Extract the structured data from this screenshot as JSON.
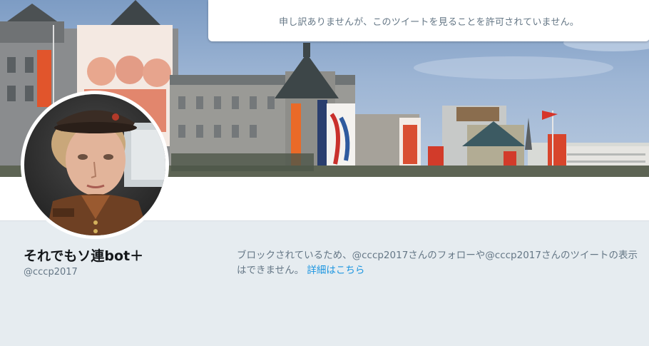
{
  "notice": {
    "text": "申し訳ありませんが、このツイートを見ることを許可されていません。"
  },
  "profile": {
    "name": "それでもソ連bot＋",
    "handle": "@cccp2017"
  },
  "blocked": {
    "message": "ブロックされているため、@cccp2017さんのフォローや@cccp2017さんのツイートの表示はできません。",
    "link_label": "詳細はこちら"
  },
  "colors": {
    "background": "#e6ecf0",
    "link": "#1b95e0",
    "muted_text": "#657786",
    "name_text": "#14171a"
  },
  "icons": {
    "banner": "header-photo",
    "avatar": "profile-photo"
  }
}
